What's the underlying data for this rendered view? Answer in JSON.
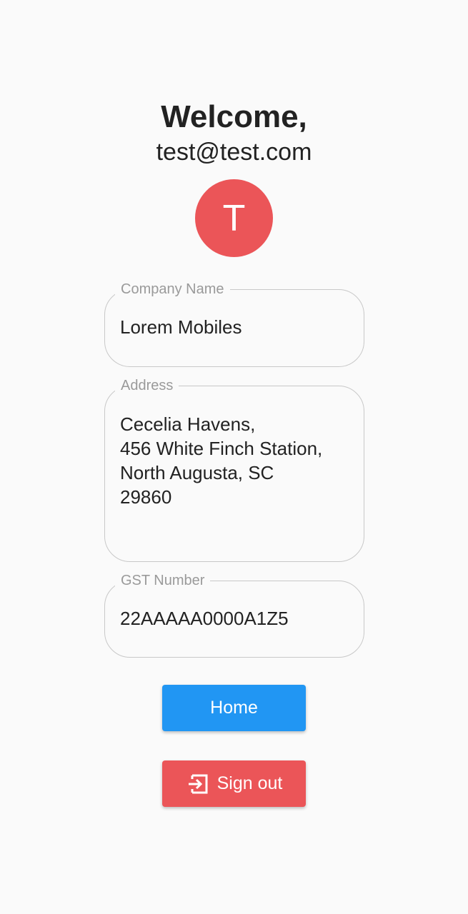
{
  "header": {
    "title": "Welcome,",
    "email": "test@test.com"
  },
  "avatar": {
    "initial": "T",
    "color": "#eb5558"
  },
  "form": {
    "company": {
      "label": "Company Name",
      "value": "Lorem Mobiles"
    },
    "address": {
      "label": "Address",
      "value": "Cecelia Havens,\n456 White Finch Station,\nNorth Augusta, SC\n29860"
    },
    "gst": {
      "label": "GST Number",
      "value": "22AAAAA0000A1Z5"
    }
  },
  "actions": {
    "home_label": "Home",
    "home_color": "#2196f3",
    "signout_label": "Sign out",
    "signout_icon": "login-arrow-icon",
    "signout_color": "#eb5558"
  }
}
